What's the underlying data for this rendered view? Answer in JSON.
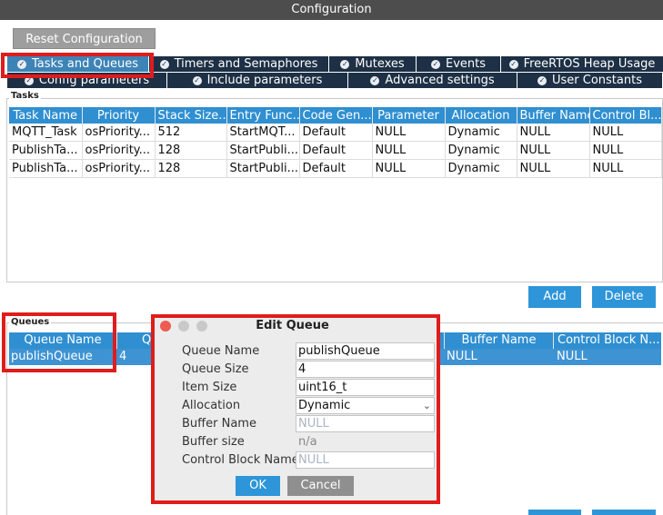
{
  "window": {
    "title": "Configuration"
  },
  "toolbar": {
    "reset_label": "Reset Configuration"
  },
  "tabs_row1": [
    {
      "label": "Tasks and Queues",
      "active": true
    },
    {
      "label": "Timers and Semaphores"
    },
    {
      "label": "Mutexes"
    },
    {
      "label": "Events"
    },
    {
      "label": "FreeRTOS Heap Usage"
    }
  ],
  "tabs_row2": [
    {
      "label": "Config parameters"
    },
    {
      "label": "Include parameters"
    },
    {
      "label": "Advanced settings"
    },
    {
      "label": "User Constants"
    }
  ],
  "tasks": {
    "group_label": "Tasks",
    "columns": [
      "Task Name",
      "Priority",
      "Stack Size...",
      "Entry Func...",
      "Code Gen...",
      "Parameter",
      "Allocation",
      "Buffer Name",
      "Control Bl..."
    ],
    "rows": [
      [
        "MQTT_Task",
        "osPriority...",
        "512",
        "StartMQT...",
        "Default",
        "NULL",
        "Dynamic",
        "NULL",
        "NULL"
      ],
      [
        "PublishTa...",
        "osPriority...",
        "128",
        "StartPubli...",
        "Default",
        "NULL",
        "Dynamic",
        "NULL",
        "NULL"
      ],
      [
        "PublishTa...",
        "osPriority...",
        "128",
        "StartPubli...",
        "Default",
        "NULL",
        "Dynamic",
        "NULL",
        "NULL"
      ]
    ],
    "add_label": "Add",
    "delete_label": "Delete"
  },
  "queues": {
    "group_label": "Queues",
    "columns": [
      "Queue Name",
      "Q",
      "Buffer Name",
      "Control Block N..."
    ],
    "row": [
      "publishQueue",
      "4",
      "NULL",
      "NULL"
    ]
  },
  "dialog": {
    "title": "Edit Queue",
    "fields": [
      {
        "label": "Queue Name",
        "value": "publishQueue"
      },
      {
        "label": "Queue Size",
        "value": "4"
      },
      {
        "label": "Item Size",
        "value": "uint16_t"
      },
      {
        "label": "Allocation",
        "value": "Dynamic"
      },
      {
        "label": "Buffer Name",
        "value": "NULL"
      },
      {
        "label": "Buffer size",
        "value": "n/a"
      },
      {
        "label": "Control Block Name",
        "value": "NULL"
      }
    ],
    "ok_label": "OK",
    "cancel_label": "Cancel"
  },
  "colors": {
    "accent": "#2f8fd1",
    "tab_dark": "#1d3045",
    "tab_active": "#3e83b6",
    "highlight": "#e01c1c"
  }
}
